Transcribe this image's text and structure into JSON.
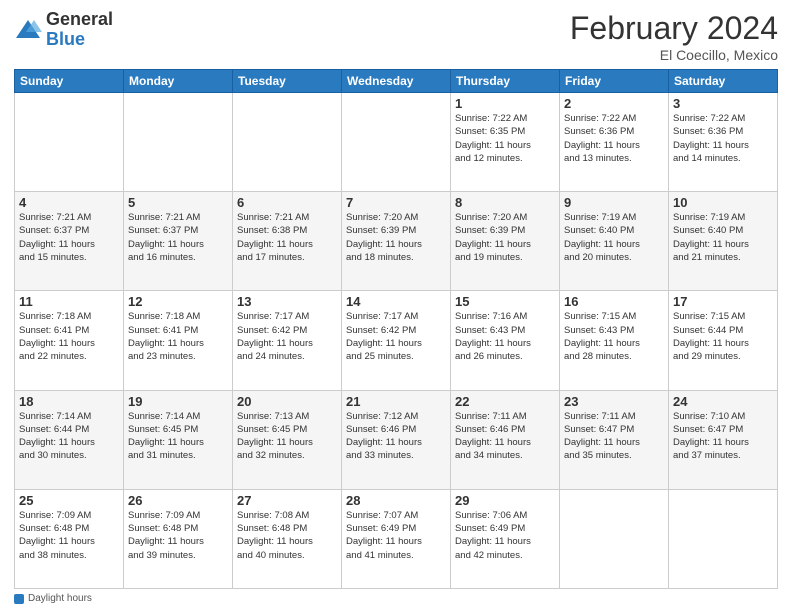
{
  "logo": {
    "general": "General",
    "blue": "Blue"
  },
  "title": "February 2024",
  "location": "El Coecillo, Mexico",
  "days_of_week": [
    "Sunday",
    "Monday",
    "Tuesday",
    "Wednesday",
    "Thursday",
    "Friday",
    "Saturday"
  ],
  "weeks": [
    [
      {
        "day": "",
        "info": ""
      },
      {
        "day": "",
        "info": ""
      },
      {
        "day": "",
        "info": ""
      },
      {
        "day": "",
        "info": ""
      },
      {
        "day": "1",
        "info": "Sunrise: 7:22 AM\nSunset: 6:35 PM\nDaylight: 11 hours\nand 12 minutes."
      },
      {
        "day": "2",
        "info": "Sunrise: 7:22 AM\nSunset: 6:36 PM\nDaylight: 11 hours\nand 13 minutes."
      },
      {
        "day": "3",
        "info": "Sunrise: 7:22 AM\nSunset: 6:36 PM\nDaylight: 11 hours\nand 14 minutes."
      }
    ],
    [
      {
        "day": "4",
        "info": "Sunrise: 7:21 AM\nSunset: 6:37 PM\nDaylight: 11 hours\nand 15 minutes."
      },
      {
        "day": "5",
        "info": "Sunrise: 7:21 AM\nSunset: 6:37 PM\nDaylight: 11 hours\nand 16 minutes."
      },
      {
        "day": "6",
        "info": "Sunrise: 7:21 AM\nSunset: 6:38 PM\nDaylight: 11 hours\nand 17 minutes."
      },
      {
        "day": "7",
        "info": "Sunrise: 7:20 AM\nSunset: 6:39 PM\nDaylight: 11 hours\nand 18 minutes."
      },
      {
        "day": "8",
        "info": "Sunrise: 7:20 AM\nSunset: 6:39 PM\nDaylight: 11 hours\nand 19 minutes."
      },
      {
        "day": "9",
        "info": "Sunrise: 7:19 AM\nSunset: 6:40 PM\nDaylight: 11 hours\nand 20 minutes."
      },
      {
        "day": "10",
        "info": "Sunrise: 7:19 AM\nSunset: 6:40 PM\nDaylight: 11 hours\nand 21 minutes."
      }
    ],
    [
      {
        "day": "11",
        "info": "Sunrise: 7:18 AM\nSunset: 6:41 PM\nDaylight: 11 hours\nand 22 minutes."
      },
      {
        "day": "12",
        "info": "Sunrise: 7:18 AM\nSunset: 6:41 PM\nDaylight: 11 hours\nand 23 minutes."
      },
      {
        "day": "13",
        "info": "Sunrise: 7:17 AM\nSunset: 6:42 PM\nDaylight: 11 hours\nand 24 minutes."
      },
      {
        "day": "14",
        "info": "Sunrise: 7:17 AM\nSunset: 6:42 PM\nDaylight: 11 hours\nand 25 minutes."
      },
      {
        "day": "15",
        "info": "Sunrise: 7:16 AM\nSunset: 6:43 PM\nDaylight: 11 hours\nand 26 minutes."
      },
      {
        "day": "16",
        "info": "Sunrise: 7:15 AM\nSunset: 6:43 PM\nDaylight: 11 hours\nand 28 minutes."
      },
      {
        "day": "17",
        "info": "Sunrise: 7:15 AM\nSunset: 6:44 PM\nDaylight: 11 hours\nand 29 minutes."
      }
    ],
    [
      {
        "day": "18",
        "info": "Sunrise: 7:14 AM\nSunset: 6:44 PM\nDaylight: 11 hours\nand 30 minutes."
      },
      {
        "day": "19",
        "info": "Sunrise: 7:14 AM\nSunset: 6:45 PM\nDaylight: 11 hours\nand 31 minutes."
      },
      {
        "day": "20",
        "info": "Sunrise: 7:13 AM\nSunset: 6:45 PM\nDaylight: 11 hours\nand 32 minutes."
      },
      {
        "day": "21",
        "info": "Sunrise: 7:12 AM\nSunset: 6:46 PM\nDaylight: 11 hours\nand 33 minutes."
      },
      {
        "day": "22",
        "info": "Sunrise: 7:11 AM\nSunset: 6:46 PM\nDaylight: 11 hours\nand 34 minutes."
      },
      {
        "day": "23",
        "info": "Sunrise: 7:11 AM\nSunset: 6:47 PM\nDaylight: 11 hours\nand 35 minutes."
      },
      {
        "day": "24",
        "info": "Sunrise: 7:10 AM\nSunset: 6:47 PM\nDaylight: 11 hours\nand 37 minutes."
      }
    ],
    [
      {
        "day": "25",
        "info": "Sunrise: 7:09 AM\nSunset: 6:48 PM\nDaylight: 11 hours\nand 38 minutes."
      },
      {
        "day": "26",
        "info": "Sunrise: 7:09 AM\nSunset: 6:48 PM\nDaylight: 11 hours\nand 39 minutes."
      },
      {
        "day": "27",
        "info": "Sunrise: 7:08 AM\nSunset: 6:48 PM\nDaylight: 11 hours\nand 40 minutes."
      },
      {
        "day": "28",
        "info": "Sunrise: 7:07 AM\nSunset: 6:49 PM\nDaylight: 11 hours\nand 41 minutes."
      },
      {
        "day": "29",
        "info": "Sunrise: 7:06 AM\nSunset: 6:49 PM\nDaylight: 11 hours\nand 42 minutes."
      },
      {
        "day": "",
        "info": ""
      },
      {
        "day": "",
        "info": ""
      }
    ]
  ],
  "footer": {
    "label": "Daylight hours"
  }
}
